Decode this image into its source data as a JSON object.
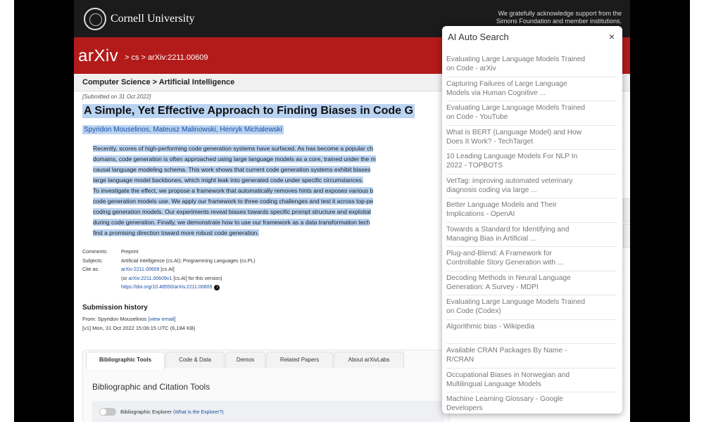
{
  "header": {
    "university": "Cornell University",
    "acknowledgement": "We gratefully acknowledge support from the Simons Foundation and member institutions."
  },
  "arxiv_bar": {
    "logo": "arXiv",
    "breadcrumb": "> cs > arXiv:2211.00609"
  },
  "subheader": "Computer Science > Artificial Intelligence",
  "paper": {
    "submitted": "[Submitted on 31 Oct 2022]",
    "title": "A Simple, Yet Effective Approach to Finding Biases in Code G",
    "authors": "Spyridon Mouselinos, Mateusz Malinowski, Henryk Michalewski",
    "abstract_lines": [
      "Recently, scores of high-performing code generation systems have surfaced. As has become a popular ch",
      "domains, code generation is often approached using large language models as a core, trained under the m",
      "causal language modeling schema. This work shows that current code generation systems exhibit biases",
      "large language model backbones, which might leak into generated code under specific circumstances.",
      "To investigate the effect, we propose a framework that automatically removes hints and exposes various b",
      "code generation models use. We apply our framework to three coding challenges and test it across top-pe",
      "coding generation models. Our experiments reveal biases towards specific prompt structure and exploitat",
      "during code generation. Finally, we demonstrate how to use our framework as a data transformation tech",
      "find a promising direction toward more robust code generation."
    ]
  },
  "metadata": {
    "comments_label": "Comments:",
    "comments_value": "Preprint",
    "subjects_label": "Subjects:",
    "subjects_value": "Artificial Intelligence (cs.AI); Programming Languages (cs.PL)",
    "cite_label": "Cite as:",
    "cite_link": "arXiv:2211.00609",
    "cite_suffix": " [cs.AI]",
    "version_prefix": "(or ",
    "version_link": "arXiv:2211.00609v1",
    "version_suffix": " [cs.AI] for this version)",
    "doi_link": "https://doi.org/10.48550/arXiv.2211.00609",
    "info_glyph": "i"
  },
  "submission_history": {
    "heading": "Submission history",
    "from_text": "From: Spyridon Mouselinos ",
    "view_email": "[view email]",
    "v1": "[v1] Mon, 31 Oct 2022 15:06:15 UTC (6,184 KB)"
  },
  "tabs": [
    {
      "label": "Bibliographic Tools"
    },
    {
      "label": "Code & Data"
    },
    {
      "label": "Demos"
    },
    {
      "label": "Related Papers"
    },
    {
      "label": "About arXivLabs"
    }
  ],
  "tools": {
    "title": "Bibliographic and Citation Tools",
    "explorer_label": "Bibliographic Explorer ",
    "explorer_link": "(What is the Explorer?)"
  },
  "popup": {
    "title": "AI Auto Search",
    "close": "×",
    "items": [
      {
        "line1": "Evaluating Large Language Models Trained",
        "line2": "on Code - arXiv"
      },
      {
        "line1": "Capturing Failures of Large Language",
        "line2": "Models via Human Cognitive ..."
      },
      {
        "line1": "Evaluating Large Language Models Trained",
        "line2": "on Code - YouTube"
      },
      {
        "line1": "What is BERT (Language Model) and How",
        "line2": "Does It Work? - TechTarget"
      },
      {
        "line1": "10 Leading Language Models For NLP In",
        "line2": "2022 - TOPBOTS"
      },
      {
        "line1": "VetTag: improving automated veterinary",
        "line2": "diagnosis coding via large ..."
      },
      {
        "line1": "Better Language Models and Their",
        "line2": "Implications - OpenAI"
      },
      {
        "line1": "Towards a Standard for Identifying and",
        "line2": "Managing Bias in Artificial ..."
      },
      {
        "line1": "Plug-and-Blend: A Framework for",
        "line2": "Controllable Story Generation with ..."
      },
      {
        "line1": "Decoding Methods in Neural Language",
        "line2": "Generation: A Survey - MDPI"
      },
      {
        "line1": "Evaluating Large Language Models Trained",
        "line2": "on Code (Codex)"
      },
      {
        "line1": "Algorithmic bias - Wikipedia",
        "line2": ""
      },
      {
        "line1": "Available CRAN Packages By Name -",
        "line2": "R/CRAN"
      },
      {
        "line1": "Occupational Biases in Norwegian and",
        "line2": "Multilingual Language Models"
      },
      {
        "line1": "Machine Learning Glossary - Google",
        "line2": "Developers"
      }
    ]
  }
}
